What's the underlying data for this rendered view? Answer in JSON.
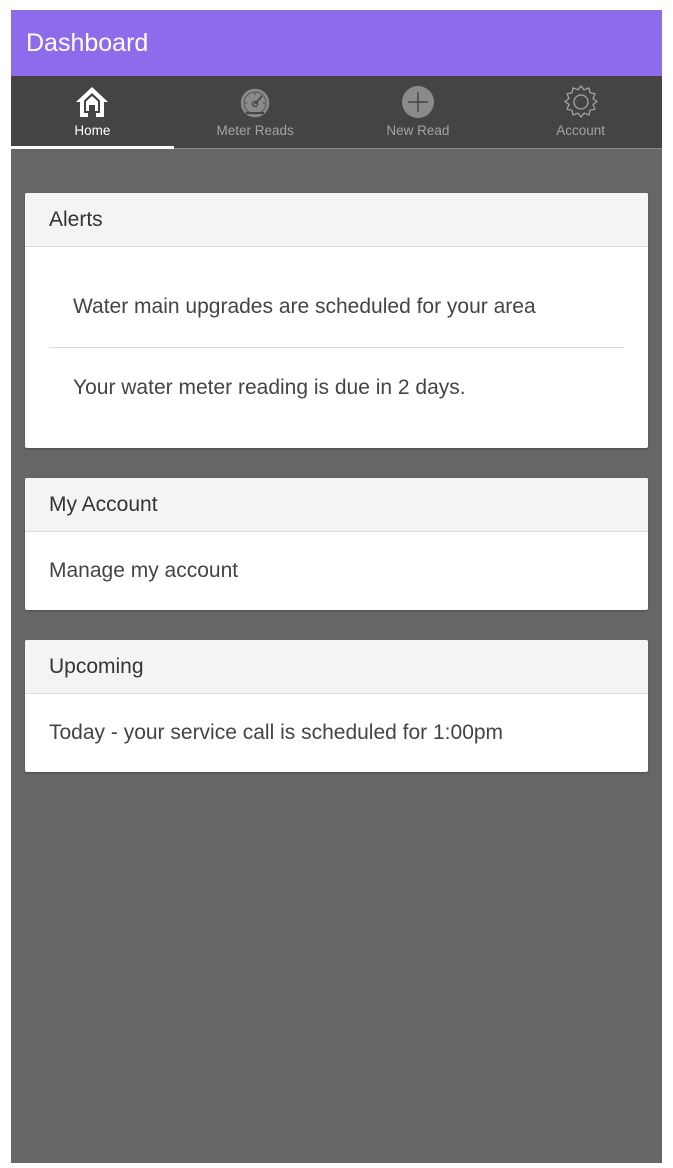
{
  "header": {
    "title": "Dashboard"
  },
  "tabs": [
    {
      "label": "Home",
      "icon": "home-icon",
      "active": true
    },
    {
      "label": "Meter Reads",
      "icon": "gauge-icon",
      "active": false
    },
    {
      "label": "New Read",
      "icon": "plus-circle-icon",
      "active": false
    },
    {
      "label": "Account",
      "icon": "gear-icon",
      "active": false
    }
  ],
  "cards": {
    "alerts": {
      "title": "Alerts",
      "items": [
        "Water main upgrades are scheduled for your area",
        "Your water meter reading is due in 2 days."
      ]
    },
    "account": {
      "title": "My Account",
      "link": "Manage my account"
    },
    "upcoming": {
      "title": "Upcoming",
      "item": "Today - your service call is scheduled for 1:00pm"
    }
  },
  "colors": {
    "header_bg": "#8e6bea",
    "tabbar_bg": "#444444",
    "page_bg": "#666666"
  }
}
